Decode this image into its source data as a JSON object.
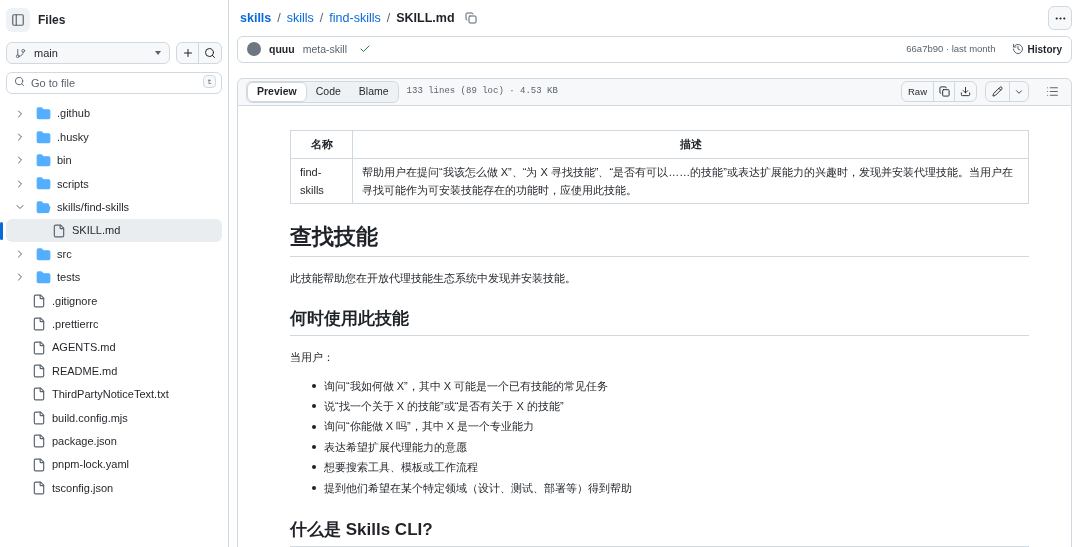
{
  "sidebar": {
    "title": "Files",
    "branch": "main",
    "search": {
      "placeholder": "Go to file",
      "shortcut": "t"
    },
    "tree": [
      {
        "kind": "folder",
        "name": ".github",
        "expanded": false,
        "selected": false
      },
      {
        "kind": "folder",
        "name": ".husky",
        "expanded": false,
        "selected": false
      },
      {
        "kind": "folder",
        "name": "bin",
        "expanded": false,
        "selected": false
      },
      {
        "kind": "folder",
        "name": "scripts",
        "expanded": false,
        "selected": false
      },
      {
        "kind": "folder",
        "name": "skills/find-skills",
        "expanded": true,
        "selected": false,
        "children": [
          {
            "kind": "file",
            "name": "SKILL.md",
            "selected": true
          }
        ]
      },
      {
        "kind": "folder",
        "name": "src",
        "expanded": false,
        "selected": false
      },
      {
        "kind": "folder",
        "name": "tests",
        "expanded": false,
        "selected": false
      },
      {
        "kind": "file",
        "name": ".gitignore",
        "selected": false
      },
      {
        "kind": "file",
        "name": ".prettierrc",
        "selected": false
      },
      {
        "kind": "file",
        "name": "AGENTS.md",
        "selected": false
      },
      {
        "kind": "file",
        "name": "README.md",
        "selected": false
      },
      {
        "kind": "file",
        "name": "ThirdPartyNoticeText.txt",
        "selected": false
      },
      {
        "kind": "file",
        "name": "build.config.mjs",
        "selected": false
      },
      {
        "kind": "file",
        "name": "package.json",
        "selected": false
      },
      {
        "kind": "file",
        "name": "pnpm-lock.yaml",
        "selected": false
      },
      {
        "kind": "file",
        "name": "tsconfig.json",
        "selected": false
      }
    ]
  },
  "breadcrumb": {
    "links": [
      "skills",
      "skills",
      "find-skills"
    ],
    "separators": [
      "/",
      "/",
      "/"
    ],
    "current": "SKILL.md"
  },
  "commit": {
    "author": "quuu",
    "message": "meta-skill",
    "hash_time": "66a7b90 · last month",
    "history": "History"
  },
  "file_header": {
    "tabs": [
      {
        "label": "Preview",
        "selected": true
      },
      {
        "label": "Code",
        "selected": false
      },
      {
        "label": "Blame",
        "selected": false
      }
    ],
    "info": "133 lines (89 loc) · 4.53 KB",
    "raw": "Raw"
  },
  "document": {
    "table": {
      "columns": [
        "名称",
        "描述"
      ],
      "rows": [
        [
          "find-skills",
          "帮助用户在提问“我该怎么做 X”、“为 X 寻找技能”、“是否有可以……的技能”或表达扩展能力的兴趣时，发现并安装代理技能。当用户在寻找可能作为可安装技能存在的功能时，应使用此技能。"
        ]
      ]
    },
    "blocks": [
      {
        "kind": "h1",
        "text": "查找技能"
      },
      {
        "kind": "p",
        "text": "此技能帮助您在开放代理技能生态系统中发现并安装技能。"
      },
      {
        "kind": "h2",
        "text": "何时使用此技能"
      },
      {
        "kind": "p",
        "text": "当用户："
      },
      {
        "kind": "list",
        "items": [
          "询问“我如何做 X”，其中 X 可能是一个已有技能的常见任务",
          "说“找一个关于 X 的技能”或“是否有关于 X 的技能”",
          "询问“你能做 X 吗”，其中 X 是一个专业能力",
          "表达希望扩展代理能力的意愿",
          "想要搜索工具、模板或工作流程",
          "提到他们希望在某个特定领域（设计、测试、部署等）得到帮助"
        ]
      },
      {
        "kind": "h2",
        "text": "什么是 Skills CLI?"
      }
    ]
  }
}
